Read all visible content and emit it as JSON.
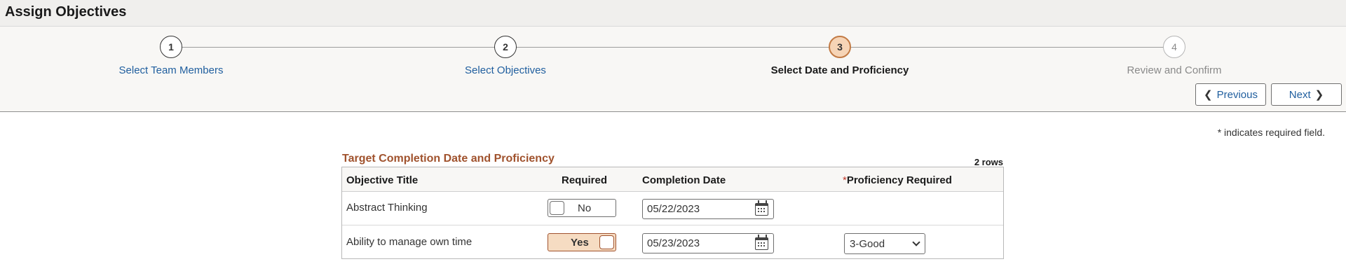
{
  "page": {
    "title": "Assign Objectives"
  },
  "steps": [
    {
      "number": "1",
      "label": "Select Team Members",
      "state": "completed"
    },
    {
      "number": "2",
      "label": "Select Objectives",
      "state": "completed"
    },
    {
      "number": "3",
      "label": "Select Date and Proficiency",
      "state": "current"
    },
    {
      "number": "4",
      "label": "Review and Confirm",
      "state": "future"
    }
  ],
  "nav": {
    "previous_label": "Previous",
    "next_label": "Next",
    "previous_icon": "chevron-left-icon",
    "next_icon": "chevron-right-icon"
  },
  "required_note": "* indicates required field.",
  "grid": {
    "title": "Target Completion Date and Proficiency",
    "row_count": "2 rows",
    "columns": {
      "objective_title": "Objective Title",
      "required": "Required",
      "completion_date": "Completion Date",
      "proficiency_star": "*",
      "proficiency": "Proficiency Required"
    },
    "rows": [
      {
        "objective_title": "Abstract Thinking",
        "required": "No",
        "completion_date": "05/22/2023",
        "proficiency": ""
      },
      {
        "objective_title": "Ability to manage own time",
        "required": "Yes",
        "completion_date": "05/23/2023",
        "proficiency": "3-Good"
      }
    ]
  },
  "colors": {
    "accent": "#a0522d",
    "link": "#1f5e9e",
    "current_step_fill": "#f6d4b6",
    "toggle_on_fill": "#f6dcc2"
  }
}
